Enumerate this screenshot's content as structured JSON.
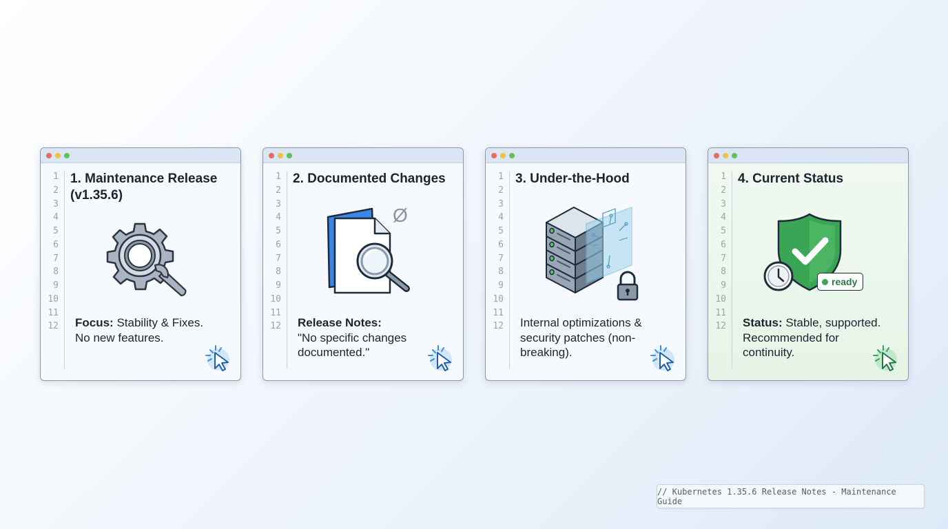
{
  "line_numbers": [
    "1",
    "2",
    "3",
    "4",
    "5",
    "6",
    "7",
    "8",
    "9",
    "10",
    "11",
    "12"
  ],
  "cards": [
    {
      "title": "1. Maintenance Release (v1.35.6)",
      "desc_label": "Focus:",
      "desc_line1": " Stability & Fixes.",
      "desc_line2": "No new features.",
      "illustration_icon": "gear-wrench-icon"
    },
    {
      "title": "2. Documented Changes",
      "desc_label": "Release Notes:",
      "desc_line1": "",
      "desc_line2": "\"No specific changes documented.\"",
      "empty_symbol": "Ø",
      "illustration_icon": "document-magnifier-icon"
    },
    {
      "title": "3. Under-the-Hood",
      "desc_label": "",
      "desc_line1": "Internal optimizations & security patches (non-breaking).",
      "desc_line2": "",
      "illustration_icon": "server-chip-lock-icon"
    },
    {
      "title": "4. Current Status",
      "desc_label": "Status:",
      "desc_line1": " Stable, supported.",
      "desc_line2": "Recommended for continuity.",
      "badge": "ready",
      "illustration_icon": "shield-check-clock-icon"
    }
  ],
  "footer": "// Kubernetes 1.35.6 Release Notes - Maintenance Guide",
  "colors": {
    "accent_blue": "#3d86e6",
    "status_green": "#3aa655",
    "cursor_blue": "#3a8fe0",
    "cursor_green": "#2fa85a"
  }
}
